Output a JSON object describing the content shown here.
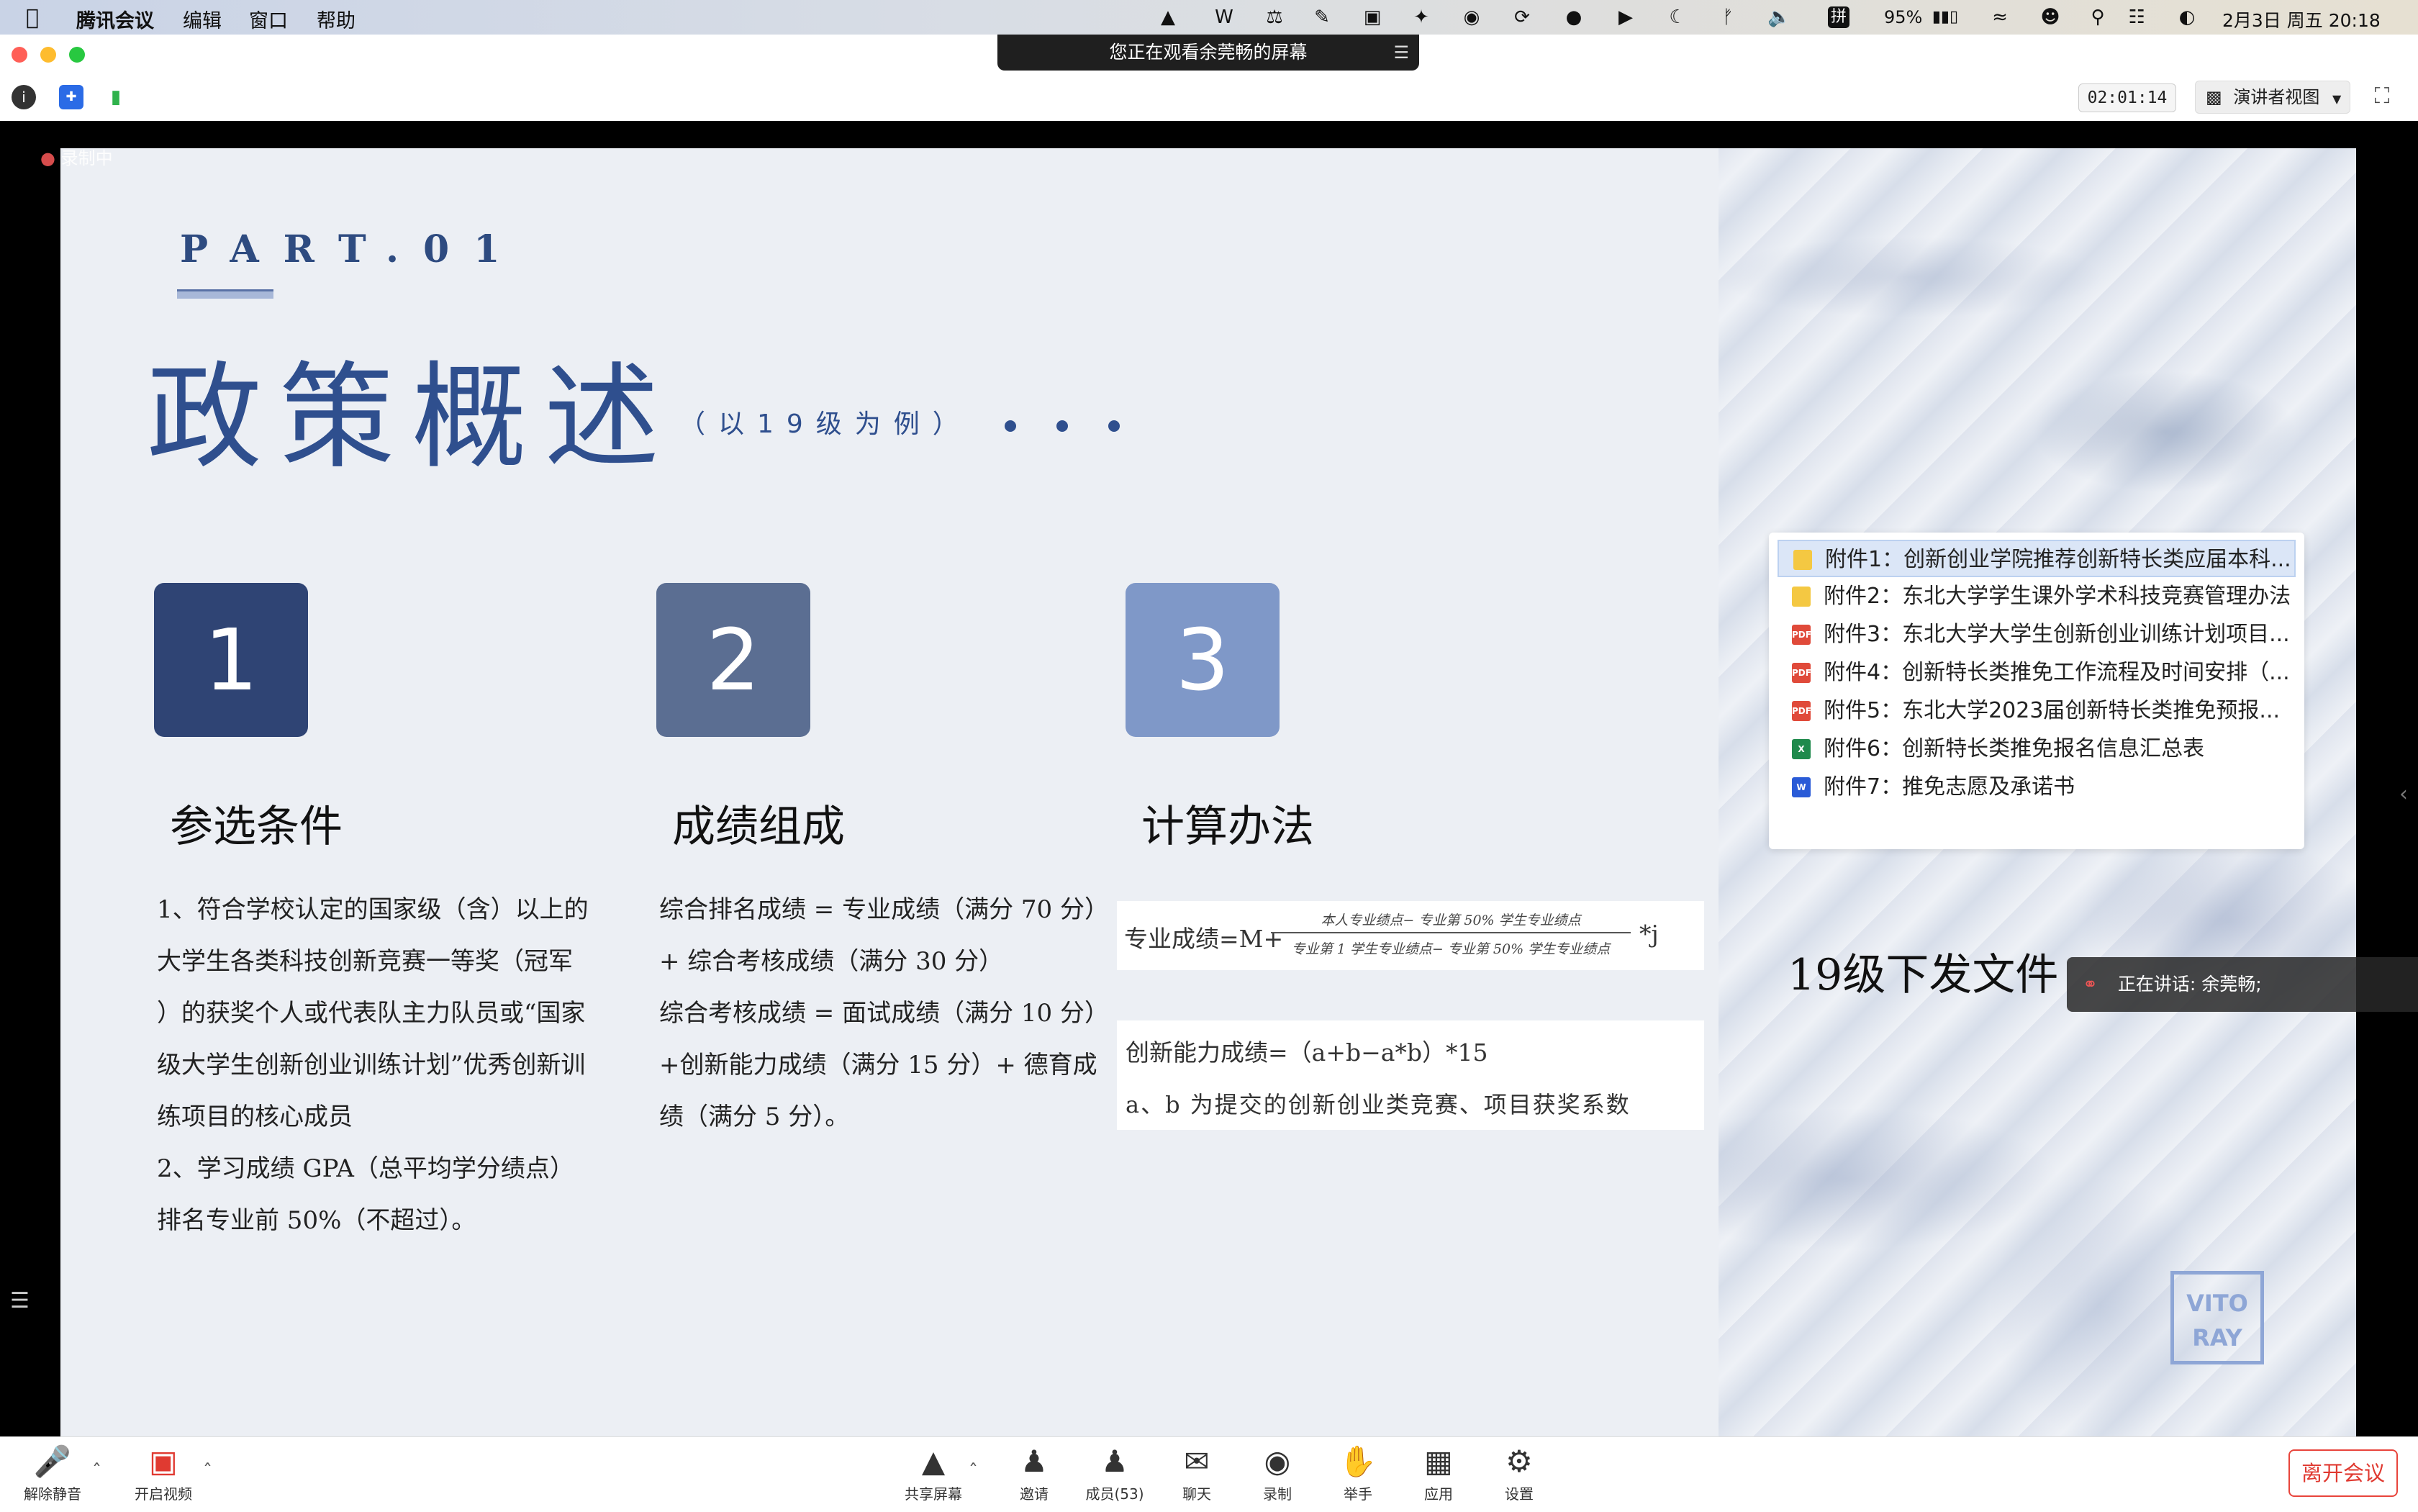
{
  "menubar": {
    "app_name": "腾讯会议",
    "items": [
      "编辑",
      "窗口",
      "帮助"
    ],
    "battery": "95%",
    "datetime": "2月3日 周五  20:18",
    "input_method": "拼"
  },
  "share_banner": {
    "text": "您正在观看余莞畅的屏幕"
  },
  "toolbar": {
    "timer": "02:01:14",
    "view_label": "演讲者视图"
  },
  "recording_badge": "录制中",
  "slide": {
    "part": "PART.01",
    "title": "政策概述",
    "subtitle": "（以19级为例）",
    "sections": [
      {
        "num": "1",
        "heading": "参选条件",
        "lines": [
          "1、符合学校认定的国家级（含）以上的",
          "大学生各类科技创新竞赛一等奖（冠军",
          "）的获奖个人或代表队主力队员或“国家",
          "级大学生创新创业训练计划”优秀创新训",
          "练项目的核心成员",
          "2、学习成绩 GPA（总平均学分绩点）",
          "排名专业前 50%（不超过）。"
        ]
      },
      {
        "num": "2",
        "heading": "成绩组成",
        "lines": [
          "综合排名成绩 = 专业成绩（满分 70 分）",
          "+ 综合考核成绩（满分 30 分）",
          "综合考核成绩 = 面试成绩（满分 10 分）",
          "+创新能力成绩（满分 15 分）+ 德育成",
          "绩（满分 5 分）。"
        ]
      },
      {
        "num": "3",
        "heading": "计算办法",
        "formula1_left": "专业成绩=M+",
        "formula1_num": "本人专业绩点− 专业第 50% 学生专业绩点",
        "formula1_den": "专业第 1 学生专业绩点− 专业第 50% 学生专业绩点",
        "formula1_right": "*j",
        "formula2": "创新能力成绩=（a+b−a*b）*15",
        "formula2_note": "a、b 为提交的创新创业类竞赛、项目获奖系数"
      }
    ],
    "files_heading": "19级下发文件",
    "attachments": [
      {
        "icon": "folder",
        "label": "附件1：创新创业学院推荐创新特长类应届本科..."
      },
      {
        "icon": "folder",
        "label": "附件2：东北大学学生课外学术科技竞赛管理办法"
      },
      {
        "icon": "pdf",
        "label": "附件3：东北大学大学生创新创业训练计划项目..."
      },
      {
        "icon": "pdf",
        "label": "附件4：创新特长类推免工作流程及时间安排（..."
      },
      {
        "icon": "pdf",
        "label": "附件5：东北大学2023届创新特长类推免预报..."
      },
      {
        "icon": "excel",
        "label": "附件6：创新特长类推免报名信息汇总表"
      },
      {
        "icon": "word",
        "label": "附件7：推免志愿及承诺书"
      }
    ],
    "stamp": {
      "line1": "VITO",
      "line2": "RAY"
    }
  },
  "speaking": {
    "text": "正在讲话: 余莞畅;"
  },
  "bottombar": {
    "unmute": "解除静音",
    "video": "开启视频",
    "share": "共享屏幕",
    "invite": "邀请",
    "members": "成员(53)",
    "chat": "聊天",
    "record": "录制",
    "raise_hand": "举手",
    "apps": "应用",
    "settings": "设置",
    "leave": "离开会议"
  },
  "colors": {
    "box1": "#2f4474",
    "box2": "#5b6e92",
    "box3": "#7f98c8",
    "title": "#2f4f8e",
    "leave": "#e03a31"
  }
}
